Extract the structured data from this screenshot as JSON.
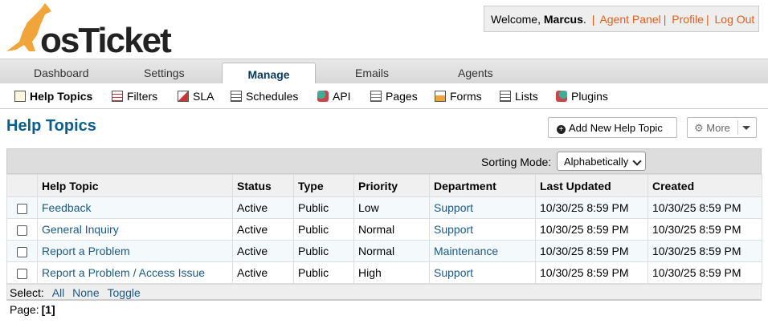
{
  "logo": {
    "text": "osTicket"
  },
  "userbox": {
    "welcome": "Welcome, ",
    "username": "Marcus",
    "after": ". ",
    "links": [
      "Agent Panel",
      "Profile",
      "Log Out"
    ]
  },
  "nav": {
    "tabs": [
      "Dashboard",
      "Settings",
      "Manage",
      "Emails",
      "Agents"
    ],
    "active": "Manage"
  },
  "subnav": {
    "items": [
      "Help Topics",
      "Filters",
      "SLA",
      "Schedules",
      "API",
      "Pages",
      "Forms",
      "Lists",
      "Plugins"
    ]
  },
  "page": {
    "title": "Help Topics",
    "add_button": "Add New Help Topic",
    "more_button": "More"
  },
  "sorting": {
    "label": "Sorting Mode:",
    "value": "Alphabetically"
  },
  "table": {
    "columns": [
      "Help Topic",
      "Status",
      "Type",
      "Priority",
      "Department",
      "Last Updated",
      "Created"
    ],
    "rows": [
      [
        "Feedback",
        "Active",
        "Public",
        "Low",
        "Support",
        "10/30/25 8:59 PM",
        "10/30/25 8:59 PM"
      ],
      [
        "General Inquiry",
        "Active",
        "Public",
        "Normal",
        "Support",
        "10/30/25 8:59 PM",
        "10/30/25 8:59 PM"
      ],
      [
        "Report a Problem",
        "Active",
        "Public",
        "Normal",
        "Maintenance",
        "10/30/25 8:59 PM",
        "10/30/25 8:59 PM"
      ],
      [
        "Report a Problem / Access Issue",
        "Active",
        "Public",
        "High",
        "Support",
        "10/30/25 8:59 PM",
        "10/30/25 8:59 PM"
      ]
    ]
  },
  "select": {
    "label": "Select:",
    "all": "All",
    "none": "None",
    "toggle": "Toggle"
  },
  "pager": {
    "label": "Page:",
    "current": "[1]"
  },
  "colors": {
    "accent": "#e55d1a",
    "title": "#0a5d8f",
    "link": "#1b5b86"
  }
}
